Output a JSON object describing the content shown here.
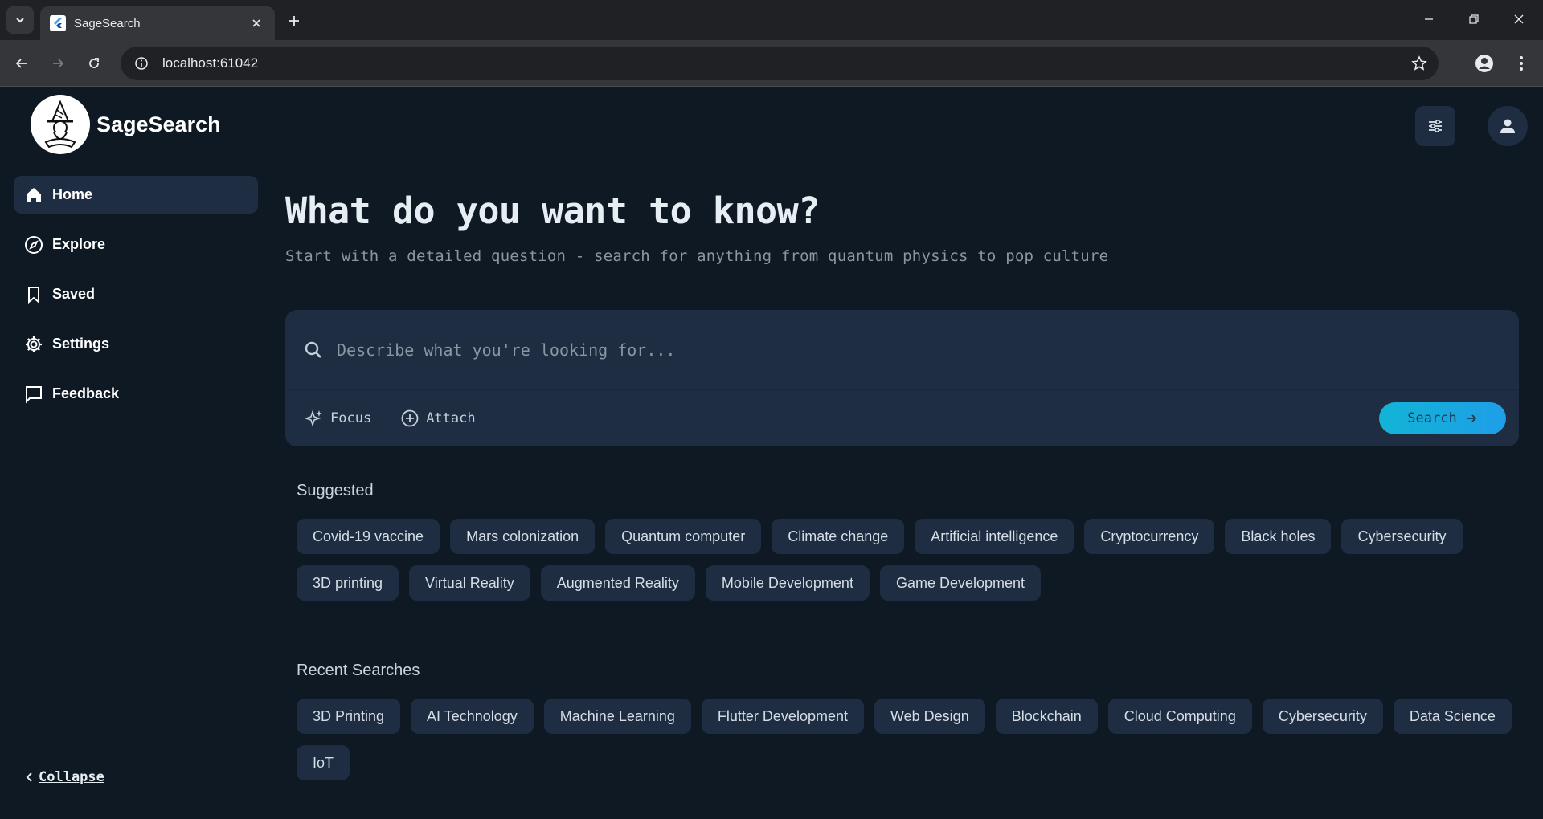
{
  "browser": {
    "tab_title": "SageSearch",
    "url": "localhost:61042"
  },
  "app": {
    "brand_name": "SageSearch",
    "sidebar": {
      "items": [
        {
          "label": "Home",
          "icon": "home-icon",
          "active": true
        },
        {
          "label": "Explore",
          "icon": "compass-icon"
        },
        {
          "label": "Saved",
          "icon": "bookmark-icon"
        },
        {
          "label": "Settings",
          "icon": "gear-icon"
        },
        {
          "label": "Feedback",
          "icon": "chat-icon"
        }
      ],
      "collapse_label": "Collapse"
    },
    "headline": "What do you want to know?",
    "subhead": "Start with a detailed question - search for anything from quantum physics to pop culture",
    "search": {
      "placeholder": "Describe what you're looking for...",
      "focus_label": "Focus",
      "attach_label": "Attach",
      "button_label": "Search"
    },
    "suggested": {
      "title": "Suggested",
      "chips": [
        "Covid-19 vaccine",
        "Mars colonization",
        "Quantum computer",
        "Climate change",
        "Artificial intelligence",
        "Cryptocurrency",
        "Black holes",
        "Cybersecurity",
        "3D printing",
        "Virtual Reality",
        "Augmented Reality",
        "Mobile Development",
        "Game Development"
      ]
    },
    "recent": {
      "title": "Recent Searches",
      "chips": [
        "3D Printing",
        "AI Technology",
        "Machine Learning",
        "Flutter Development",
        "Web Design",
        "Blockchain",
        "Cloud Computing",
        "Cybersecurity",
        "Data Science",
        "IoT"
      ]
    },
    "colors": {
      "background": "#0f1923",
      "surface": "#1e2d42",
      "accent": "#12b4d6"
    }
  }
}
